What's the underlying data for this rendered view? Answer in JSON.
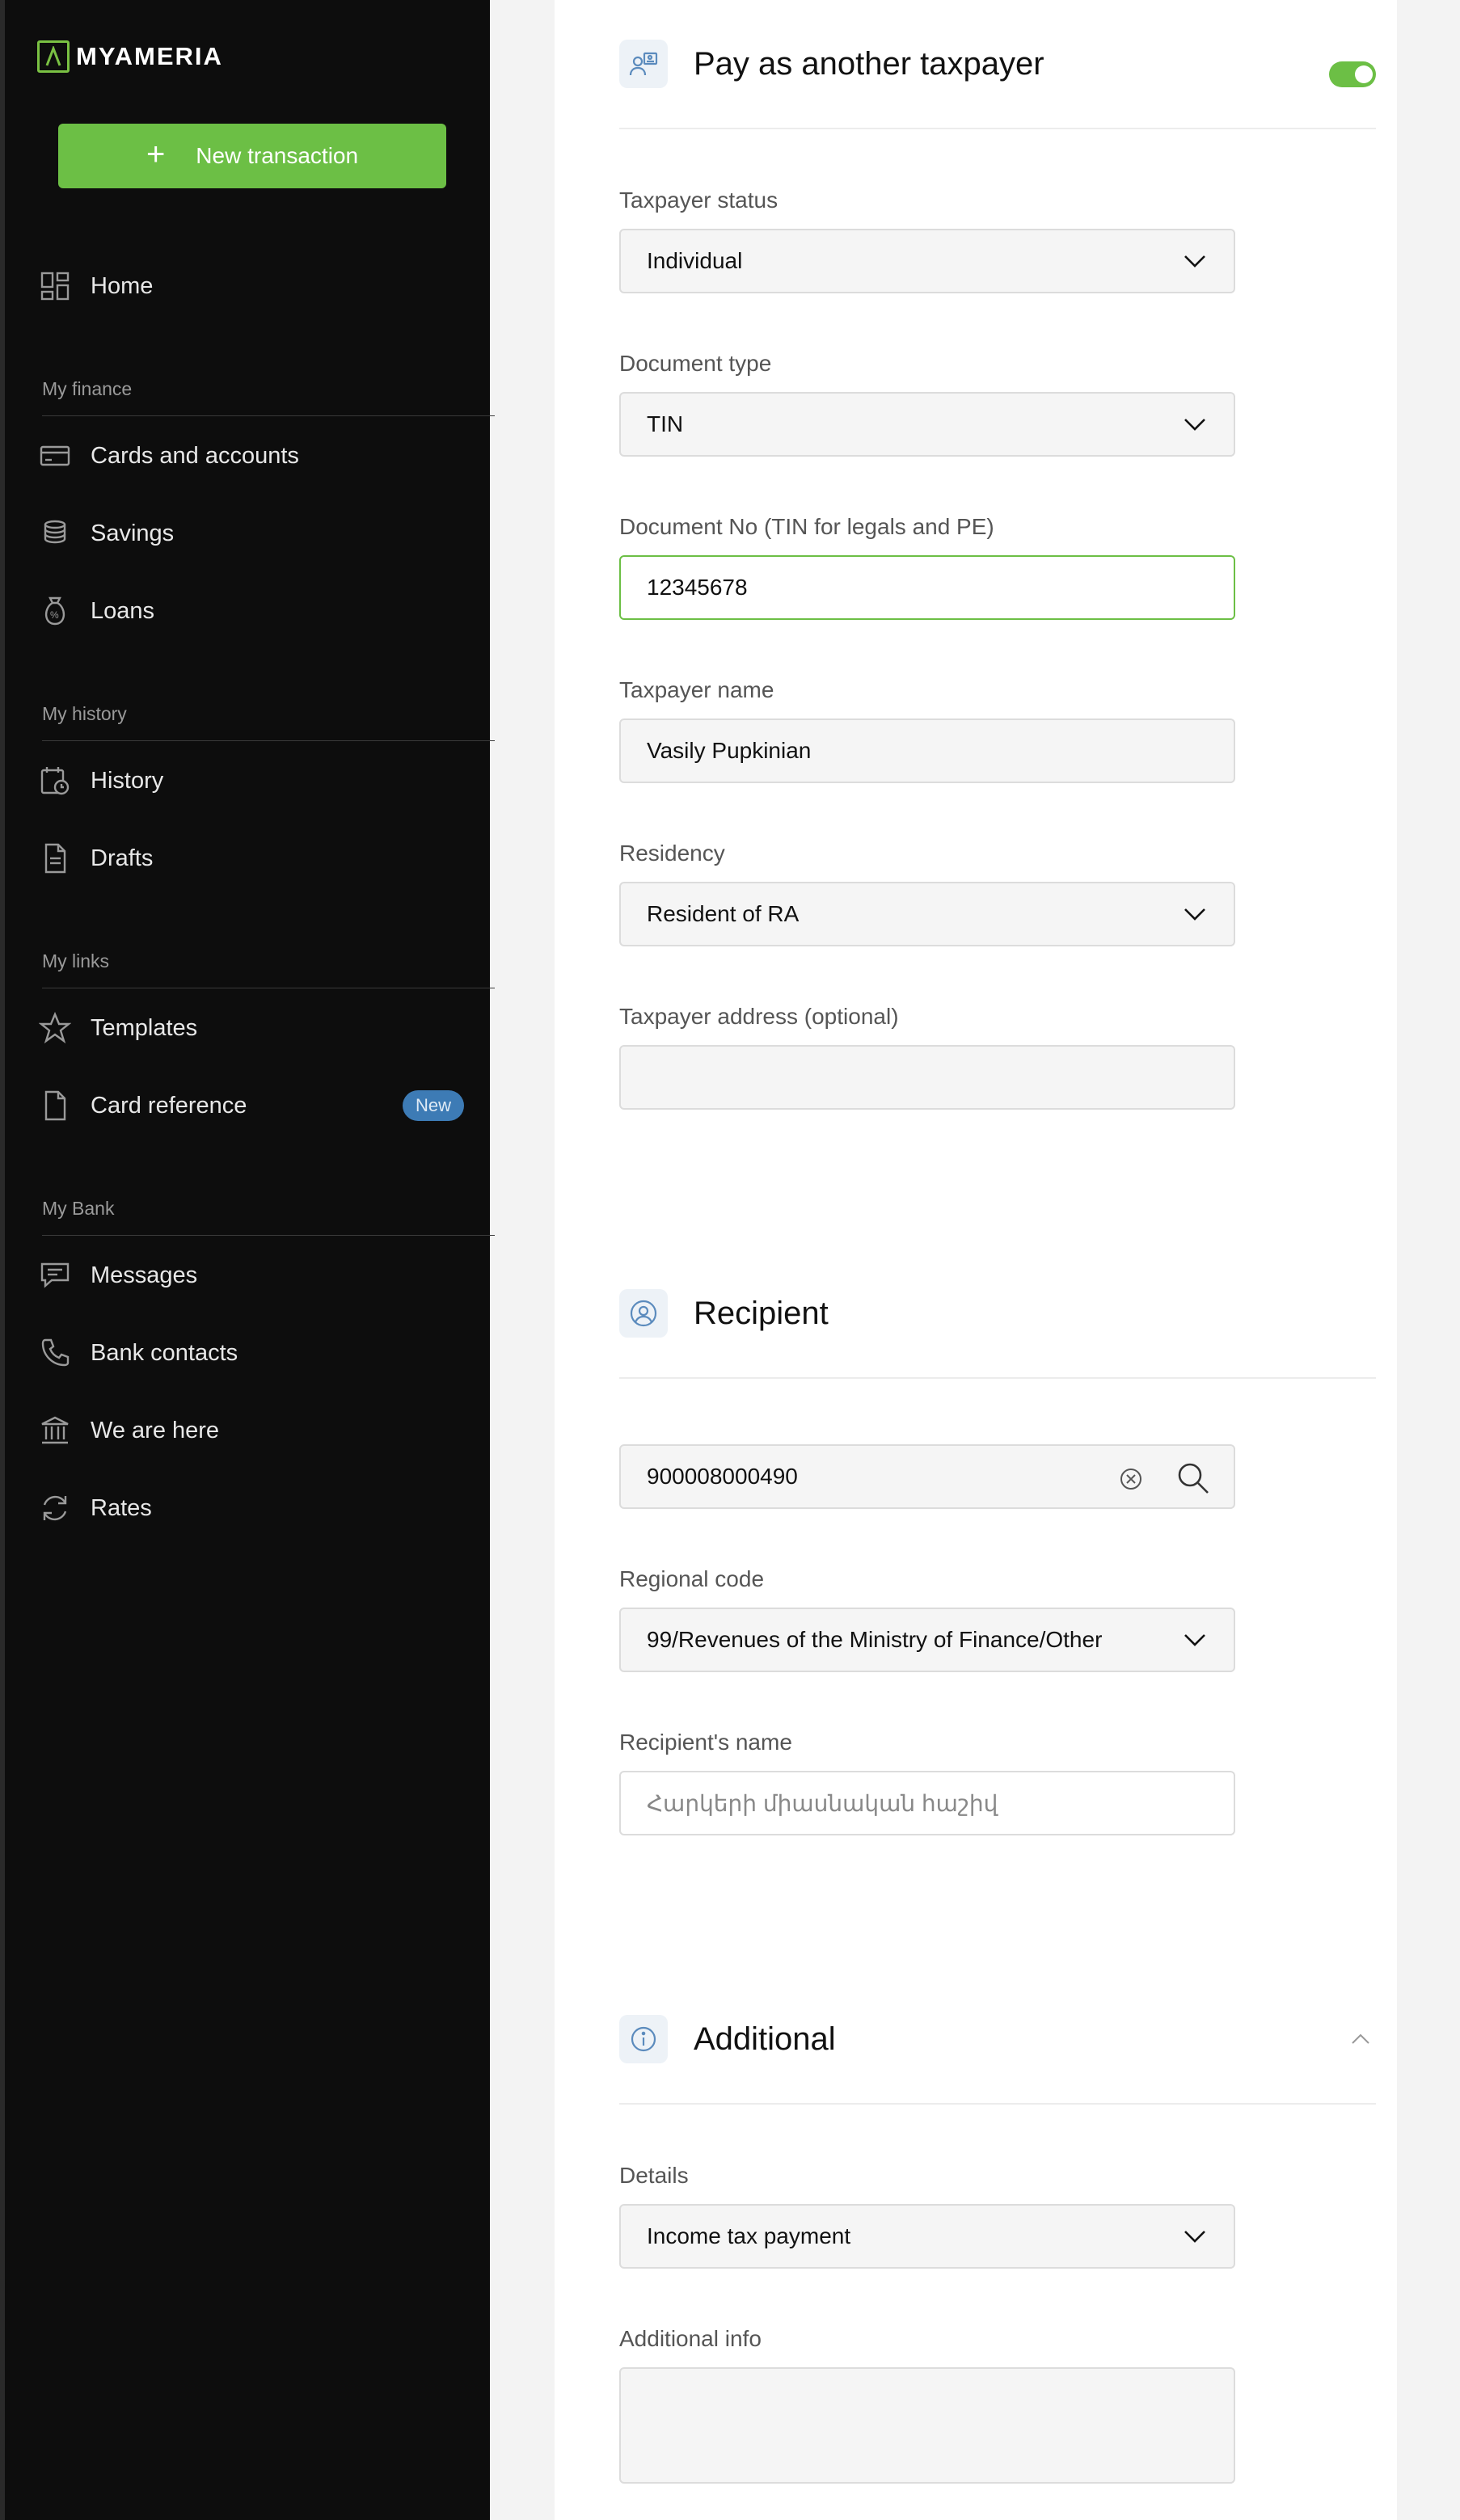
{
  "brand": {
    "logo_mark": "Λ",
    "logo_my": "MY",
    "logo_rest": "AMERIA"
  },
  "sidebar": {
    "new_transaction": "New transaction",
    "home": "Home",
    "sections": {
      "finance": "My finance",
      "history": "My history",
      "links": "My links",
      "bank": "My Bank"
    },
    "items": {
      "cards": "Cards and accounts",
      "savings": "Savings",
      "loans": "Loans",
      "history": "History",
      "drafts": "Drafts",
      "templates": "Templates",
      "card_reference": "Card reference",
      "card_reference_badge": "New",
      "messages": "Messages",
      "bank_contacts": "Bank contacts",
      "we_are_here": "We are here",
      "rates": "Rates"
    }
  },
  "taxpayer": {
    "title": "Pay as another taxpayer",
    "toggle_on": true,
    "status_label": "Taxpayer status",
    "status_value": "Individual",
    "doc_type_label": "Document type",
    "doc_type_value": "TIN",
    "doc_no_label": "Document No (TIN for legals and PE)",
    "doc_no_value": "12345678",
    "name_label": "Taxpayer name",
    "name_value": "Vasily Pupkinian",
    "residency_label": "Residency",
    "residency_value": "Resident of RA",
    "address_label": "Taxpayer address (optional)",
    "address_value": ""
  },
  "recipient": {
    "title": "Recipient",
    "account_value": "900008000490",
    "regional_label": "Regional code",
    "regional_value": "99/Revenues of the Ministry of Finance/Other",
    "name_label": "Recipient's name",
    "name_placeholder": "Հարկերի միասնական հաշիվ"
  },
  "additional": {
    "title": "Additional",
    "details_label": "Details",
    "details_value": "Income tax payment",
    "info_label": "Additional info",
    "info_value": ""
  },
  "colors": {
    "accent": "#6cbf45",
    "sidebar_bg": "#0d0d0d",
    "badge": "#3d7bb5",
    "icon_blue": "#5b8bbd"
  }
}
